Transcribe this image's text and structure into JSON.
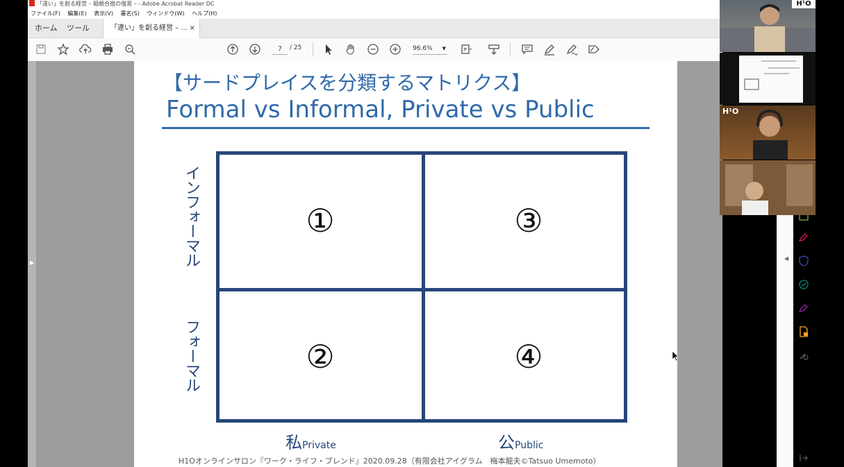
{
  "window": {
    "title": "「違い」を創る経営 – 稲根合宿の復習 – - Adobe Acrobat Reader DC"
  },
  "menu": [
    "ファイル(F)",
    "編集(E)",
    "表示(V)",
    "署名(S)",
    "ウィンドウ(W)",
    "ヘルプ(H)"
  ],
  "tabs": {
    "home": "ホーム",
    "tools": "ツール",
    "document": "「違い」を創る経営 – ...",
    "close": "×"
  },
  "toolbar": {
    "page_current": "7",
    "page_total": "/ 25",
    "zoom": "96.6%"
  },
  "slide": {
    "heading_jp": "【サードプレイスを分類するマトリクス】",
    "heading_en": "Formal vs Informal, Private vs Public",
    "axis_y_top": "インフォーマル",
    "axis_y_bottom": "フォーマル",
    "axis_x_left_big": "私",
    "axis_x_left_small": "Private",
    "axis_x_right_big": "公",
    "axis_x_right_small": "Public",
    "quadrants": {
      "q1": "①",
      "q2": "②",
      "q3": "③",
      "q4": "④"
    },
    "footer": "H1Oオンラインサロン『ワーク・ライフ・ブレンド』2020.09.28（有限会社アイグラム　梅本龍夫©Tatsuo Umemoto）"
  },
  "video": {
    "badge": "H¹O",
    "overlay": "H¹O"
  },
  "colors": {
    "heading_blue": "#2f6aaa",
    "matrix_navy": "#27467a",
    "viewer_gray": "#9d9d9d"
  }
}
